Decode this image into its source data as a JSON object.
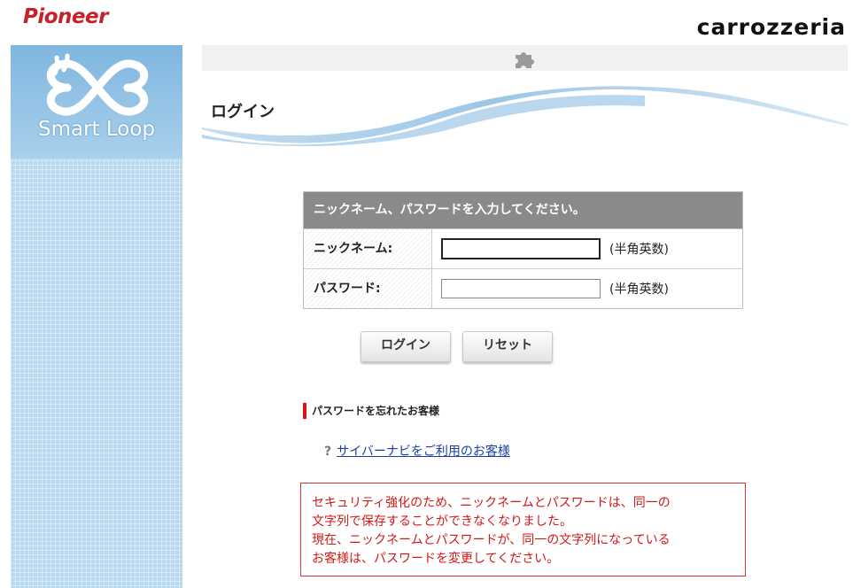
{
  "brands": {
    "left": "Pioneer",
    "right": "carrozzeria"
  },
  "sidebar": {
    "logo_text": "Smart Loop"
  },
  "page": {
    "title": "ログイン"
  },
  "form": {
    "header": "ニックネーム、パスワードを入力してください。",
    "nickname": {
      "label": "ニックネーム:",
      "value": "",
      "note": "(半角英数)"
    },
    "password": {
      "label": "パスワード:",
      "value": "",
      "note": "(半角英数)"
    },
    "login_button": "ログイン",
    "reset_button": "リセット"
  },
  "forgot": {
    "title": "パスワードを忘れたお客様",
    "link_icon": "?",
    "link_text": "サイバーナビをご利用のお客様"
  },
  "notice": {
    "lines": [
      "セキュリティ強化のため、ニックネームとパスワードは、同一の",
      "文字列で保存することができなくなりました。",
      "現在、ニックネームとパスワードが、同一の文字列になっている",
      "お客様は、パスワードを変更してください。"
    ]
  },
  "colors": {
    "brand_red": "#c8202a",
    "form_header_bg": "#8a8a8a",
    "link": "#1b3fa0",
    "notice": "#d01818",
    "sidebar_blue": "#b9d9ef"
  },
  "icons": {
    "sidebar_logo": "smart-loop-infinity-logo",
    "topbar": "puzzle-piece-icon"
  }
}
